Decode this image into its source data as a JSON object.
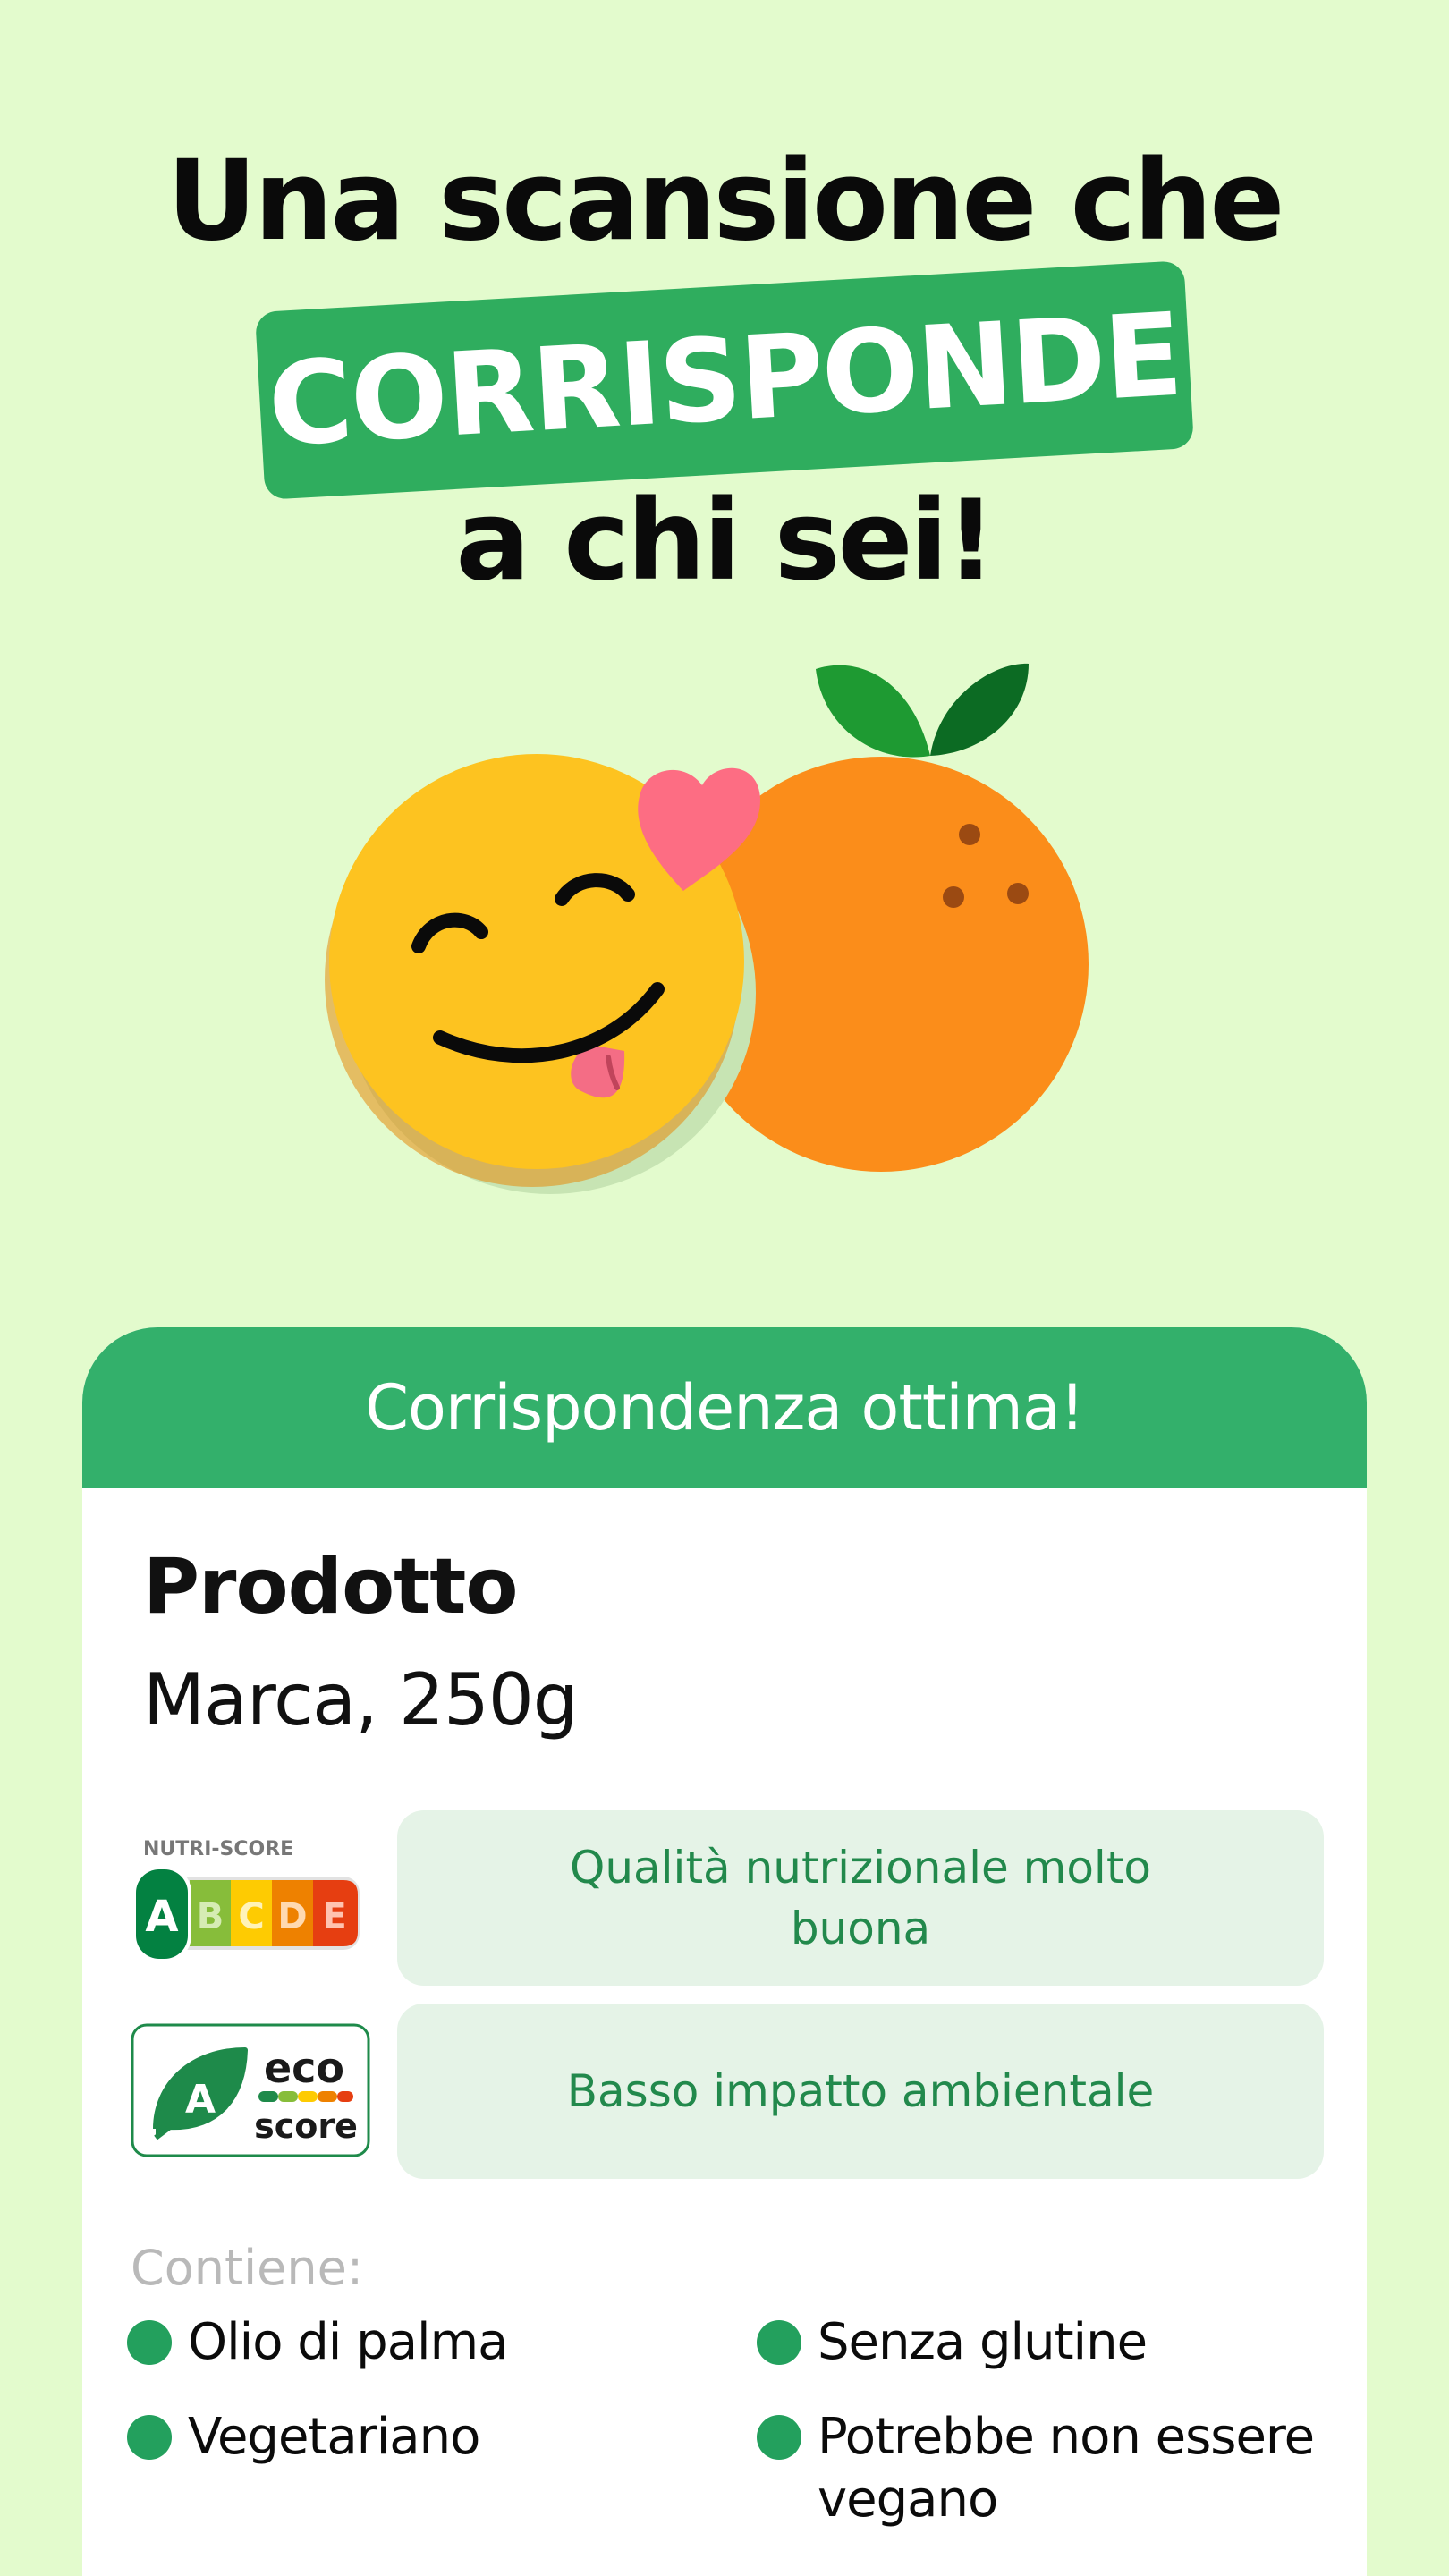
{
  "headline": {
    "line1": "Una scansione che",
    "highlight": "CORRISPONDE",
    "line3": "a chi sei!"
  },
  "illustration": {
    "icons": [
      "smiling-face-icon",
      "orange-fruit-icon",
      "heart-icon",
      "leaf-icon"
    ]
  },
  "card": {
    "header": "Corrispondenza ottima!",
    "product": {
      "name": "Prodotto",
      "brand": "Marca, 250g"
    },
    "nutri_score": {
      "logo_label": "NUTRI-SCORE",
      "grade": "A",
      "letters": [
        "A",
        "B",
        "C",
        "D",
        "E"
      ],
      "description": "Qualità nutrizionale molto buona"
    },
    "eco_score": {
      "grade": "A",
      "word1": "eco",
      "word2": "score",
      "description": "Basso impatto ambientale"
    },
    "contains_label": "Contiene:",
    "tags": [
      "Olio di palma",
      "Senza glutine",
      "Vegetariano",
      "Potrebbe non essere vegano"
    ]
  },
  "colors": {
    "background": "#e3fbcd",
    "brand_green": "#33b06b",
    "badge_fill": "#e5f3e7",
    "badge_text": "#22894c",
    "dot": "#23a05d"
  }
}
